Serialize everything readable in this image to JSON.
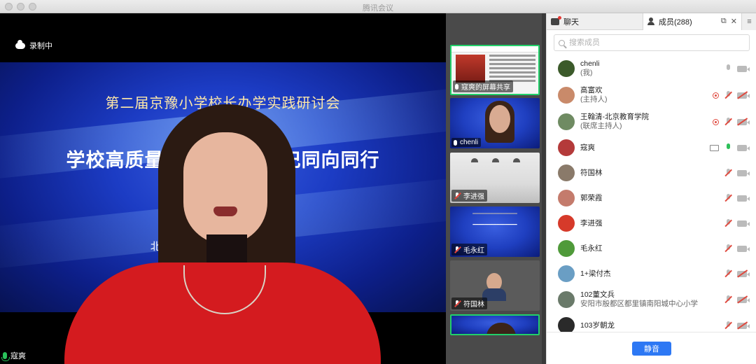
{
  "window": {
    "title": "腾讯会议"
  },
  "colors": {
    "accent": "#2d78f4",
    "active_border": "#22d06a",
    "mute_red": "#e04a3f",
    "live_green": "#2ec05a"
  },
  "main": {
    "recording_label": "录制中",
    "slide": {
      "line1": "第二届京豫小学校长办学实践研讨会",
      "line2": "学校高质量发展：校长书记同向同行",
      "line3": "北京教育学院 · 校长办公室"
    },
    "speaker_name": "寇爽"
  },
  "thumbnails": [
    {
      "label": "寇爽的屏幕共享",
      "mic": "on",
      "type": "doc",
      "active": true
    },
    {
      "label": "chenli",
      "mic": "on",
      "type": "person"
    },
    {
      "label": "李进强",
      "mic": "muted",
      "type": "room"
    },
    {
      "label": "毛永红",
      "mic": "muted",
      "type": "blue"
    },
    {
      "label": "符国林",
      "mic": "muted",
      "type": "gray"
    },
    {
      "label": "",
      "mic": "",
      "type": "blue_person"
    }
  ],
  "panel": {
    "tab_chat": "聊天",
    "tab_members": "成员(288)",
    "search_placeholder": "搜索成员",
    "members": [
      {
        "name": "chenli",
        "sub": "(我)",
        "avatar_color": "#3b5a2a",
        "rec": false,
        "screen": false,
        "mic": "plain",
        "cam": "plain"
      },
      {
        "name": "高富欢",
        "sub": "(主持人)",
        "avatar_color": "#c98a6a",
        "rec": true,
        "screen": false,
        "mic": "muted",
        "cam": "off"
      },
      {
        "name": "王翰清-北京教育学院",
        "sub": "(联席主持人)",
        "avatar_color": "#6f8b62",
        "rec": true,
        "screen": false,
        "mic": "muted",
        "cam": "off"
      },
      {
        "name": "寇爽",
        "sub": "",
        "avatar_color": "#b43a3a",
        "rec": false,
        "screen": true,
        "mic": "live",
        "cam": "plain"
      },
      {
        "name": "符国林",
        "sub": "",
        "avatar_color": "#8a7a6a",
        "rec": false,
        "screen": false,
        "mic": "muted",
        "cam": "plain"
      },
      {
        "name": "郭荣霞",
        "sub": "",
        "avatar_color": "#c47b6c",
        "rec": false,
        "screen": false,
        "mic": "muted",
        "cam": "plain"
      },
      {
        "name": "李进强",
        "sub": "",
        "avatar_color": "#d63a2a",
        "rec": false,
        "screen": false,
        "mic": "muted",
        "cam": "plain"
      },
      {
        "name": "毛永红",
        "sub": "",
        "avatar_color": "#4f9a3a",
        "rec": false,
        "screen": false,
        "mic": "muted",
        "cam": "plain"
      },
      {
        "name": "1+梁付杰",
        "sub": "",
        "avatar_color": "#6a9ec4",
        "rec": false,
        "screen": false,
        "mic": "muted",
        "cam": "off"
      },
      {
        "name": "102董文兵",
        "sub": "安阳市殷都区都里镇南阳城中心小学",
        "avatar_color": "#6a7a6a",
        "rec": false,
        "screen": false,
        "mic": "muted",
        "cam": "off"
      },
      {
        "name": "103岁朝龙",
        "sub": "",
        "avatar_color": "#2a2a2a",
        "rec": false,
        "screen": false,
        "mic": "muted",
        "cam": "off"
      }
    ],
    "mute_all_label": "静音"
  }
}
